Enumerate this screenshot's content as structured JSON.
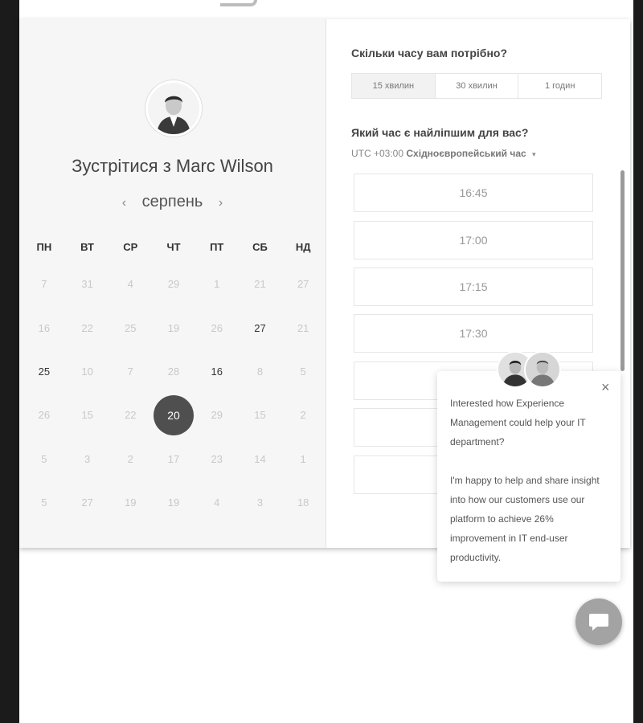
{
  "scheduler": {
    "title": "Зустрітися з Marc Wilson",
    "month": "серпень",
    "prev_arrow": "‹",
    "next_arrow": "›",
    "weekdays": [
      "ПН",
      "ВТ",
      "СР",
      "ЧТ",
      "ПТ",
      "СБ",
      "НД"
    ],
    "weeks": [
      [
        {
          "d": "7"
        },
        {
          "d": "31"
        },
        {
          "d": "4"
        },
        {
          "d": "29"
        },
        {
          "d": "1"
        },
        {
          "d": "21"
        },
        {
          "d": "27"
        }
      ],
      [
        {
          "d": "16"
        },
        {
          "d": "22"
        },
        {
          "d": "25"
        },
        {
          "d": "19"
        },
        {
          "d": "26"
        },
        {
          "d": "27",
          "avail": true
        },
        {
          "d": "21"
        }
      ],
      [
        {
          "d": "25",
          "avail": true
        },
        {
          "d": "10"
        },
        {
          "d": "7"
        },
        {
          "d": "28"
        },
        {
          "d": "16",
          "avail": true
        },
        {
          "d": "8"
        },
        {
          "d": "5"
        }
      ],
      [
        {
          "d": "26"
        },
        {
          "d": "15"
        },
        {
          "d": "22"
        },
        {
          "d": "20",
          "selected": true
        },
        {
          "d": "29"
        },
        {
          "d": "15"
        },
        {
          "d": "2"
        }
      ],
      [
        {
          "d": "5"
        },
        {
          "d": "3"
        },
        {
          "d": "2"
        },
        {
          "d": "17"
        },
        {
          "d": "23"
        },
        {
          "d": "14"
        },
        {
          "d": "1"
        }
      ],
      [
        {
          "d": "5"
        },
        {
          "d": "27"
        },
        {
          "d": "19"
        },
        {
          "d": "19"
        },
        {
          "d": "4"
        },
        {
          "d": "3"
        },
        {
          "d": "18"
        }
      ]
    ]
  },
  "booking": {
    "duration_question": "Скільки часу вам потрібно?",
    "durations": [
      "15 хвилин",
      "30 хвилин",
      "1 годин"
    ],
    "time_question": "Який час є найліпшим для вас?",
    "tz_offset": "UTC +03:00",
    "tz_name": "Східноєвропейський час",
    "tz_caret": "▾",
    "slots": [
      "16:45",
      "17:00",
      "17:15",
      "17:30"
    ]
  },
  "chat": {
    "message_1": "Interested how Experience Management could help your IT department?",
    "message_2": "I'm happy to help and share insight into how our customers use our platform to achieve 26% improvement in IT end-user productivity.",
    "close": "×"
  },
  "icons": {
    "avatar": "person-portrait",
    "chat": "chat-bubble-icon",
    "close": "close-icon"
  },
  "colors": {
    "selected_day": "#4f4f4f",
    "chat_button": "#a3a3a3"
  }
}
